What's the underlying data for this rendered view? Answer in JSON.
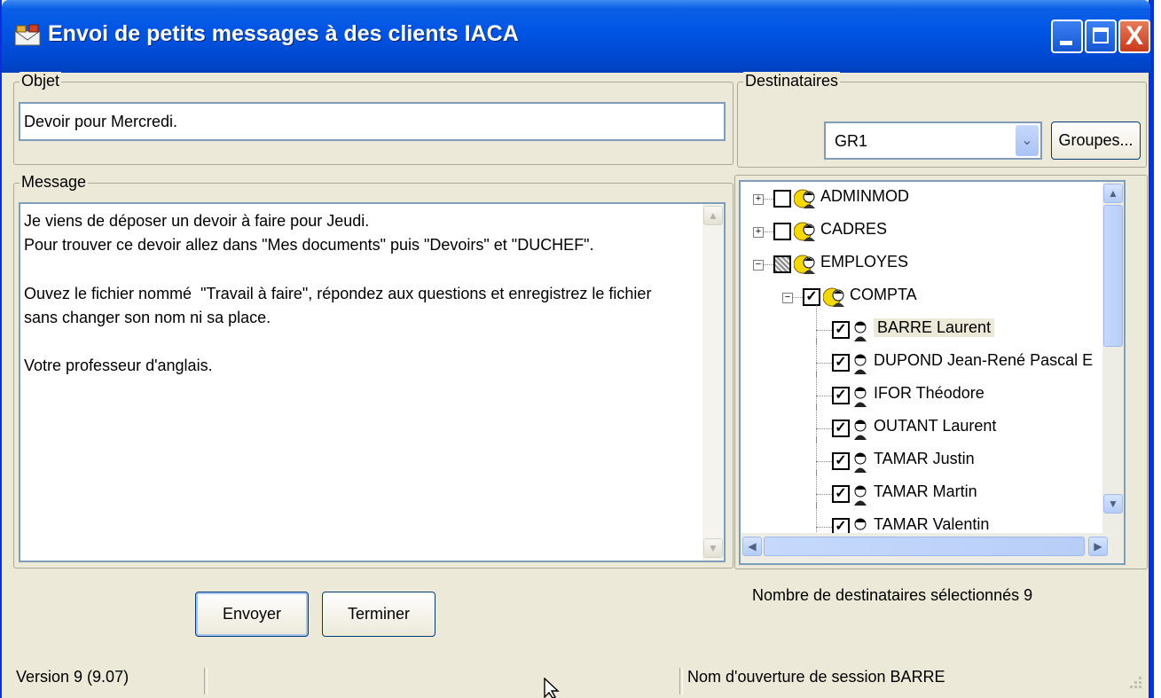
{
  "window": {
    "title": "Envoi de petits messages à des clients IACA",
    "buttons": {
      "minimize": "minimize",
      "maximize": "maximize",
      "close": "X"
    }
  },
  "objet": {
    "legend": "Objet",
    "value": "Devoir pour Mercredi."
  },
  "message": {
    "legend": "Message",
    "body": "Je viens de déposer un devoir à faire pour Jeudi.\nPour trouver ce devoir allez dans \"Mes documents\" puis \"Devoirs\" et \"DUCHEF\".\n\nOuvez le fichier nommé  \"Travail à faire\", répondez aux questions et enregistrez le fichier\nsans changer son nom ni sa place.\n\nVotre professeur d'anglais."
  },
  "destinataires": {
    "legend": "Destinataires",
    "group_select": "GR1",
    "groups_button": "Groupes...",
    "tree": [
      {
        "label": "ADMINMOD",
        "type": "group",
        "level": 0,
        "expanded": false,
        "checked": "unchecked"
      },
      {
        "label": "CADRES",
        "type": "group",
        "level": 0,
        "expanded": false,
        "checked": "unchecked"
      },
      {
        "label": "EMPLOYES",
        "type": "group",
        "level": 0,
        "expanded": true,
        "checked": "partial"
      },
      {
        "label": "COMPTA",
        "type": "group",
        "level": 1,
        "expanded": true,
        "checked": "checked"
      },
      {
        "label": "BARRE Laurent",
        "type": "user",
        "level": 2,
        "checked": "checked",
        "selected": true
      },
      {
        "label": "DUPOND Jean-René Pascal E",
        "type": "user",
        "level": 2,
        "checked": "checked"
      },
      {
        "label": "IFOR Théodore",
        "type": "user",
        "level": 2,
        "checked": "checked"
      },
      {
        "label": "OUTANT Laurent",
        "type": "user",
        "level": 2,
        "checked": "checked"
      },
      {
        "label": "TAMAR Justin",
        "type": "user",
        "level": 2,
        "checked": "checked"
      },
      {
        "label": "TAMAR Martin",
        "type": "user",
        "level": 2,
        "checked": "checked"
      },
      {
        "label": "TAMAR Valentin",
        "type": "user",
        "level": 2,
        "checked": "checked"
      }
    ],
    "count_text": "Nombre de destinataires sélectionnés 9"
  },
  "actions": {
    "send": "Envoyer",
    "finish": "Terminer"
  },
  "status": {
    "version": "Version 9 (9.07)",
    "session": "Nom d'ouverture de session BARRE"
  },
  "colors": {
    "titlebar": "#0054e3",
    "window_bg": "#ece9d8",
    "field_border": "#7f9db9",
    "close_button": "#c93a1b"
  },
  "icons": {
    "app": "envelope-icon",
    "group": "group-users-icon",
    "user": "user-icon"
  }
}
